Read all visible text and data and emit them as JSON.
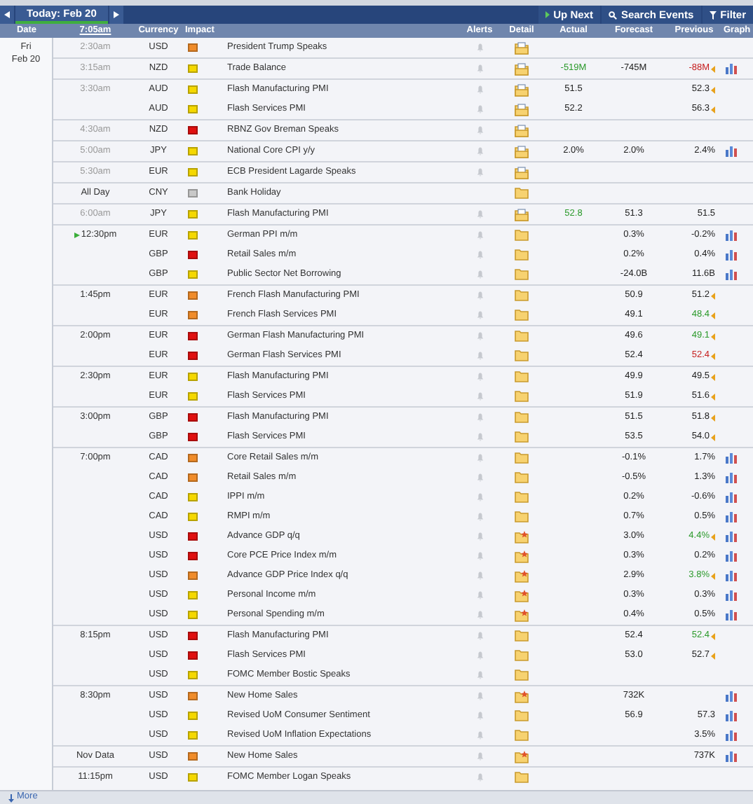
{
  "toolbar": {
    "today": "Today: Feb 20",
    "up_next": "Up Next",
    "search": "Search Events",
    "filter": "Filter"
  },
  "header": {
    "date": "Date",
    "time": "7:05am",
    "currency": "Currency",
    "impact": "Impact",
    "alerts": "Alerts",
    "detail": "Detail",
    "actual": "Actual",
    "forecast": "Forecast",
    "previous": "Previous",
    "graph": "Graph"
  },
  "day": {
    "weekday": "Fri",
    "date": "Feb 20"
  },
  "groups": [
    {
      "time": "2:30am",
      "past": true,
      "next": false,
      "rows": [
        {
          "currency": "USD",
          "color": "#f08c2a",
          "event": "President Trump Speaks",
          "alert": true,
          "kind": "doc",
          "graph": false
        }
      ]
    },
    {
      "time": "3:15am",
      "past": true,
      "next": false,
      "rows": [
        {
          "currency": "NZD",
          "color": "#f5d800",
          "event": "Trade Balance",
          "alert": true,
          "kind": "doc",
          "actual": "-519M",
          "actual_beat": true,
          "forecast": "-745M",
          "previous": "-88M",
          "previous_down": true,
          "revised": true,
          "graph": true
        }
      ]
    },
    {
      "time": "3:30am",
      "past": true,
      "next": false,
      "rows": [
        {
          "currency": "AUD",
          "color": "#f5d800",
          "event": "Flash Manufacturing PMI",
          "alert": true,
          "kind": "doc",
          "actual": "51.5",
          "previous": "52.3",
          "revised": true,
          "graph": false
        },
        {
          "currency": "AUD",
          "color": "#f5d800",
          "event": "Flash Services PMI",
          "alert": true,
          "kind": "doc",
          "actual": "52.2",
          "previous": "56.3",
          "revised": true,
          "graph": false
        }
      ]
    },
    {
      "time": "4:30am",
      "past": true,
      "next": false,
      "rows": [
        {
          "currency": "NZD",
          "color": "#e01010",
          "event": "RBNZ Gov Breman Speaks",
          "alert": true,
          "kind": "doc",
          "graph": false
        }
      ]
    },
    {
      "time": "5:00am",
      "past": true,
      "next": false,
      "rows": [
        {
          "currency": "JPY",
          "color": "#f5d800",
          "event": "National Core CPI y/y",
          "alert": true,
          "kind": "doc",
          "actual": "2.0%",
          "forecast": "2.0%",
          "previous": "2.4%",
          "revised": false,
          "graph": true
        }
      ]
    },
    {
      "time": "5:30am",
      "past": true,
      "next": false,
      "rows": [
        {
          "currency": "EUR",
          "color": "#f5d800",
          "event": "ECB President Lagarde Speaks",
          "alert": true,
          "kind": "doc",
          "graph": false
        }
      ]
    },
    {
      "time": "All Day",
      "past": false,
      "next": false,
      "rows": [
        {
          "currency": "CNY",
          "color": "#c8c8c8",
          "event": "Bank Holiday",
          "alert": false,
          "kind": "plain",
          "graph": false
        }
      ]
    },
    {
      "time": "6:00am",
      "past": true,
      "next": false,
      "rows": [
        {
          "currency": "JPY",
          "color": "#f5d800",
          "event": "Flash Manufacturing PMI",
          "alert": true,
          "kind": "doc",
          "actual": "52.8",
          "actual_beat": true,
          "forecast": "51.3",
          "previous": "51.5",
          "revised": false,
          "graph": false
        }
      ]
    },
    {
      "time": "12:30pm",
      "past": false,
      "next": true,
      "rows": [
        {
          "currency": "EUR",
          "color": "#f5d800",
          "event": "German PPI m/m",
          "alert": true,
          "kind": "plain",
          "forecast": "0.3%",
          "previous": "-0.2%",
          "revised": false,
          "graph": true
        },
        {
          "currency": "GBP",
          "color": "#e01010",
          "event": "Retail Sales m/m",
          "alert": true,
          "kind": "plain",
          "forecast": "0.2%",
          "previous": "0.4%",
          "revised": false,
          "graph": true
        },
        {
          "currency": "GBP",
          "color": "#f5d800",
          "event": "Public Sector Net Borrowing",
          "alert": true,
          "kind": "plain",
          "forecast": "-24.0B",
          "previous": "11.6B",
          "revised": false,
          "graph": true
        }
      ]
    },
    {
      "time": "1:45pm",
      "past": false,
      "next": false,
      "rows": [
        {
          "currency": "EUR",
          "color": "#f08c2a",
          "event": "French Flash Manufacturing PMI",
          "alert": true,
          "kind": "plain",
          "forecast": "50.9",
          "previous": "51.2",
          "revised": true,
          "graph": false
        },
        {
          "currency": "EUR",
          "color": "#f08c2a",
          "event": "French Flash Services PMI",
          "alert": true,
          "kind": "plain",
          "forecast": "49.1",
          "previous": "48.4",
          "previous_up": true,
          "revised": true,
          "graph": false
        }
      ]
    },
    {
      "time": "2:00pm",
      "past": false,
      "next": false,
      "rows": [
        {
          "currency": "EUR",
          "color": "#e01010",
          "event": "German Flash Manufacturing PMI",
          "alert": true,
          "kind": "plain",
          "forecast": "49.6",
          "previous": "49.1",
          "previous_up": true,
          "revised": true,
          "graph": false
        },
        {
          "currency": "EUR",
          "color": "#e01010",
          "event": "German Flash Services PMI",
          "alert": true,
          "kind": "plain",
          "forecast": "52.4",
          "previous": "52.4",
          "previous_down": true,
          "revised": true,
          "graph": false
        }
      ]
    },
    {
      "time": "2:30pm",
      "past": false,
      "next": false,
      "rows": [
        {
          "currency": "EUR",
          "color": "#f5d800",
          "event": "Flash Manufacturing PMI",
          "alert": true,
          "kind": "plain",
          "forecast": "49.9",
          "previous": "49.5",
          "revised": true,
          "graph": false
        },
        {
          "currency": "EUR",
          "color": "#f5d800",
          "event": "Flash Services PMI",
          "alert": true,
          "kind": "plain",
          "forecast": "51.9",
          "previous": "51.6",
          "revised": true,
          "graph": false
        }
      ]
    },
    {
      "time": "3:00pm",
      "past": false,
      "next": false,
      "rows": [
        {
          "currency": "GBP",
          "color": "#e01010",
          "event": "Flash Manufacturing PMI",
          "alert": true,
          "kind": "plain",
          "forecast": "51.5",
          "previous": "51.8",
          "revised": true,
          "graph": false
        },
        {
          "currency": "GBP",
          "color": "#e01010",
          "event": "Flash Services PMI",
          "alert": true,
          "kind": "plain",
          "forecast": "53.5",
          "previous": "54.0",
          "revised": true,
          "graph": false
        }
      ]
    },
    {
      "time": "7:00pm",
      "past": false,
      "next": false,
      "rows": [
        {
          "currency": "CAD",
          "color": "#f08c2a",
          "event": "Core Retail Sales m/m",
          "alert": true,
          "kind": "plain",
          "forecast": "-0.1%",
          "previous": "1.7%",
          "revised": false,
          "graph": true
        },
        {
          "currency": "CAD",
          "color": "#f08c2a",
          "event": "Retail Sales m/m",
          "alert": true,
          "kind": "plain",
          "forecast": "-0.5%",
          "previous": "1.3%",
          "revised": false,
          "graph": true
        },
        {
          "currency": "CAD",
          "color": "#f5d800",
          "event": "IPPI m/m",
          "alert": true,
          "kind": "plain",
          "forecast": "0.2%",
          "previous": "-0.6%",
          "revised": false,
          "graph": true
        },
        {
          "currency": "CAD",
          "color": "#f5d800",
          "event": "RMPI m/m",
          "alert": true,
          "kind": "plain",
          "forecast": "0.7%",
          "previous": "0.5%",
          "revised": false,
          "graph": true
        },
        {
          "currency": "USD",
          "color": "#e01010",
          "event": "Advance GDP q/q",
          "alert": true,
          "kind": "star",
          "forecast": "3.0%",
          "previous": "4.4%",
          "previous_up": true,
          "revised": true,
          "graph": true
        },
        {
          "currency": "USD",
          "color": "#e01010",
          "event": "Core PCE Price Index m/m",
          "alert": true,
          "kind": "star",
          "forecast": "0.3%",
          "previous": "0.2%",
          "revised": false,
          "graph": true
        },
        {
          "currency": "USD",
          "color": "#f08c2a",
          "event": "Advance GDP Price Index q/q",
          "alert": true,
          "kind": "star",
          "forecast": "2.9%",
          "previous": "3.8%",
          "previous_up": true,
          "revised": true,
          "graph": true
        },
        {
          "currency": "USD",
          "color": "#f5d800",
          "event": "Personal Income m/m",
          "alert": true,
          "kind": "star",
          "forecast": "0.3%",
          "previous": "0.3%",
          "revised": false,
          "graph": true
        },
        {
          "currency": "USD",
          "color": "#f5d800",
          "event": "Personal Spending m/m",
          "alert": true,
          "kind": "star",
          "forecast": "0.4%",
          "previous": "0.5%",
          "revised": false,
          "graph": true
        }
      ]
    },
    {
      "time": "8:15pm",
      "past": false,
      "next": false,
      "rows": [
        {
          "currency": "USD",
          "color": "#e01010",
          "event": "Flash Manufacturing PMI",
          "alert": true,
          "kind": "plain",
          "forecast": "52.4",
          "previous": "52.4",
          "previous_up": true,
          "revised": true,
          "graph": false
        },
        {
          "currency": "USD",
          "color": "#e01010",
          "event": "Flash Services PMI",
          "alert": true,
          "kind": "plain",
          "forecast": "53.0",
          "previous": "52.7",
          "revised": true,
          "graph": false
        },
        {
          "currency": "USD",
          "color": "#f5d800",
          "event": "FOMC Member Bostic Speaks",
          "alert": true,
          "kind": "plain",
          "graph": false
        }
      ]
    },
    {
      "time": "8:30pm",
      "past": false,
      "next": false,
      "rows": [
        {
          "currency": "USD",
          "color": "#f08c2a",
          "event": "New Home Sales",
          "alert": true,
          "kind": "star",
          "forecast": "732K",
          "revised": false,
          "graph": true
        },
        {
          "currency": "USD",
          "color": "#f5d800",
          "event": "Revised UoM Consumer Sentiment",
          "alert": true,
          "kind": "plain",
          "forecast": "56.9",
          "previous": "57.3",
          "revised": false,
          "graph": true
        },
        {
          "currency": "USD",
          "color": "#f5d800",
          "event": "Revised UoM Inflation Expectations",
          "alert": true,
          "kind": "plain",
          "previous": "3.5%",
          "revised": false,
          "graph": true
        }
      ]
    },
    {
      "time": "Nov Data",
      "past": false,
      "next": false,
      "rows": [
        {
          "currency": "USD",
          "color": "#f08c2a",
          "event": "New Home Sales",
          "alert": true,
          "kind": "star",
          "previous": "737K",
          "revised": false,
          "graph": true
        }
      ]
    },
    {
      "time": "11:15pm",
      "past": false,
      "next": false,
      "rows": [
        {
          "currency": "USD",
          "color": "#f5d800",
          "event": "FOMC Member Logan Speaks",
          "alert": true,
          "kind": "plain",
          "graph": false
        }
      ]
    }
  ],
  "footer": {
    "more": "More"
  }
}
